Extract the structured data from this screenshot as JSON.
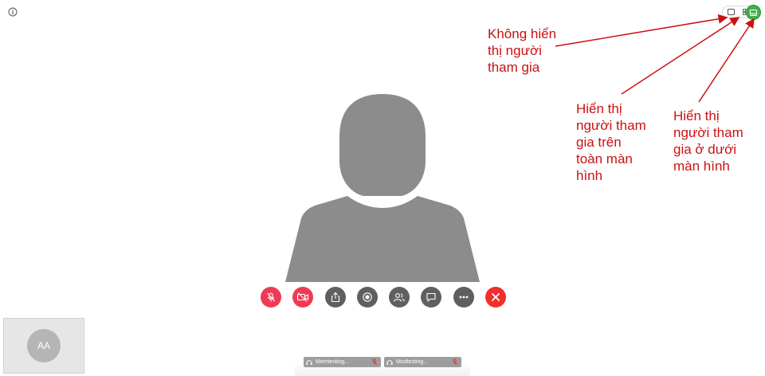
{
  "icons": {
    "info": "info-circle-icon",
    "layout_none": "single-window-icon",
    "layout_grid": "grid-icon",
    "layout_bottom": "filmstrip-bottom-icon",
    "mic": "microphone-off-icon",
    "camera": "camera-off-icon",
    "share": "share-icon",
    "record": "record-icon",
    "participants": "participants-icon",
    "chat": "chat-icon",
    "more": "more-icon",
    "end": "end-call-icon",
    "headset": "headset-icon",
    "tile_mute": "microphone-off-icon"
  },
  "colors": {
    "annotation": "#cc1111",
    "red_button": "#ee3b55",
    "gray_button": "#5f5f5f",
    "end_button": "#f03030",
    "active_layout": "#3db348",
    "arrow": "#cc1111"
  },
  "annotations": [
    {
      "lines": [
        "Không hiển",
        "thị người",
        "tham gia"
      ]
    },
    {
      "lines": [
        "Hiển thị",
        "người tham",
        "gia trên",
        "toàn màn",
        "hình"
      ]
    },
    {
      "lines": [
        "Hiển thị",
        "người tham",
        "gia ở dưới",
        "màn hình"
      ]
    }
  ],
  "self_view": {
    "initials": "AA"
  },
  "participants": [
    {
      "name": "Memtesting..."
    },
    {
      "name": "Modtesting..."
    }
  ]
}
